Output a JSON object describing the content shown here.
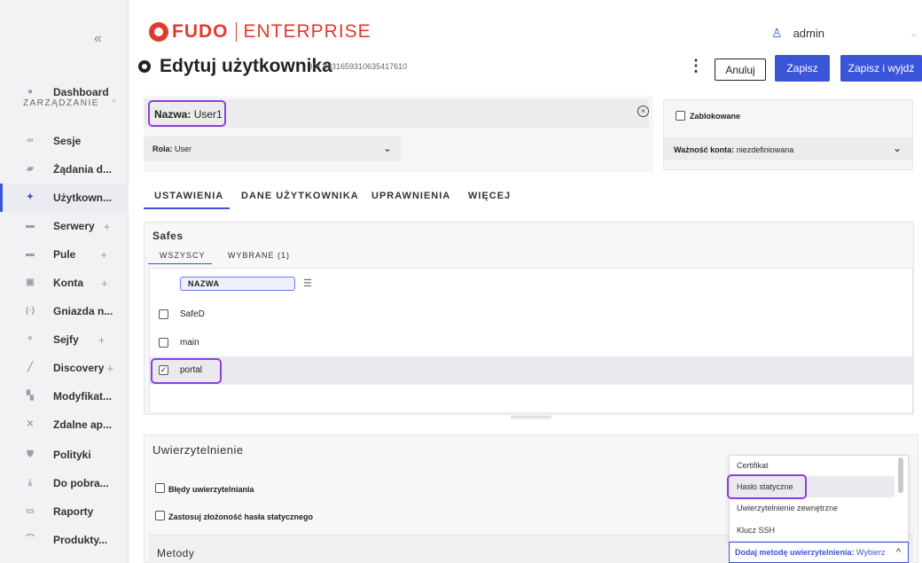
{
  "sidebar": {
    "collapse_glyph": "«",
    "dashboard": "Dashboard",
    "section": "ZARZĄDZANIE",
    "items": [
      {
        "label": "Sesje",
        "icon": "sessions-icon",
        "plus": ""
      },
      {
        "label": "Żądania d...",
        "icon": "requests-icon",
        "plus": ""
      },
      {
        "label": "Użytkown...",
        "icon": "users-icon",
        "plus": "+"
      },
      {
        "label": "Serwery",
        "icon": "servers-icon",
        "plus": "+"
      },
      {
        "label": "Pule",
        "icon": "pools-icon",
        "plus": "+"
      },
      {
        "label": "Konta",
        "icon": "accounts-icon",
        "plus": "+"
      },
      {
        "label": "Gniazda n...",
        "icon": "listeners-icon",
        "plus": "+"
      },
      {
        "label": "Sejfy",
        "icon": "safes-icon",
        "plus": "+"
      },
      {
        "label": "Discovery",
        "icon": "discovery-icon",
        "plus": "+"
      },
      {
        "label": "Modyfikat...",
        "icon": "modifiers-icon",
        "plus": "+"
      },
      {
        "label": "Zdalne ap...",
        "icon": "remote-apps-icon",
        "plus": "+"
      },
      {
        "label": "Polityki",
        "icon": "policies-icon",
        "plus": ""
      },
      {
        "label": "Do pobra...",
        "icon": "download-icon",
        "plus": ""
      },
      {
        "label": "Raporty",
        "icon": "reports-icon",
        "plus": ""
      },
      {
        "label": "Produkty...",
        "icon": "products-icon",
        "plus": ""
      }
    ]
  },
  "header": {
    "brand_1": "FUDO",
    "brand_2": "ENTERPRISE",
    "user": "admin"
  },
  "page": {
    "title": "Edytuj użytkownika",
    "id_text": "ID: 8331659310635417610",
    "cancel": "Anuluj",
    "save": "Zapisz",
    "save_exit": "Zapisz i wyjdź"
  },
  "form": {
    "name_label": "Nazwa:",
    "name_value": "User1",
    "role_label": "Rola:",
    "role_value": "User",
    "blocked_label": "Zablokowane",
    "validity_label": "Ważność konta:",
    "validity_value": "niezdefiniowana"
  },
  "tabs": [
    "USTAWIENIA",
    "DANE UŻYTKOWNIKA",
    "UPRAWNIENIA",
    "WIĘCEJ"
  ],
  "safes": {
    "title": "Safes",
    "subtabs": [
      "WSZYSCY",
      "WYBRANE (1)"
    ],
    "column": "NAZWA",
    "rows": [
      {
        "label": "SafeD",
        "checked": false
      },
      {
        "label": "main",
        "checked": false
      },
      {
        "label": "portal",
        "checked": true
      }
    ]
  },
  "auth": {
    "title": "Uwierzytelnienie",
    "opt1": "Błędy uwierzytelniania",
    "opt2": "Zastosuj złożoność hasła statycznego",
    "methods_title": "Metody",
    "dropdown": [
      "Certifikat",
      "Hasło statyczne",
      "Uwierzytelnienie zewnętrzne",
      "Klucz SSH"
    ],
    "add_label": "Dodaj metodę uwierzytelnienia:",
    "add_value": "Wybierz"
  },
  "colors": {
    "accent": "#3b55d9",
    "brand": "#e23b2e",
    "highlight": "#8b3fe0"
  }
}
